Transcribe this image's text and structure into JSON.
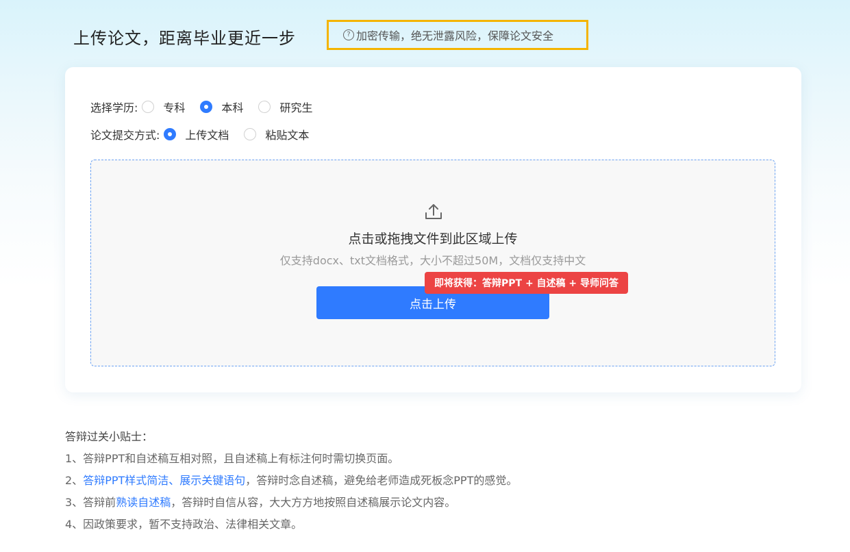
{
  "header": {
    "title": "上传论文，距离毕业更近一步",
    "notice": "加密传输，绝无泄露风险，保障论文安全",
    "notice_icon": "question-circle-icon"
  },
  "form": {
    "education_label": "选择学历:",
    "education_options": [
      {
        "label": "专科",
        "checked": false
      },
      {
        "label": "本科",
        "checked": true
      },
      {
        "label": "研究生",
        "checked": false
      }
    ],
    "submit_label": "论文提交方式:",
    "submit_options": [
      {
        "label": "上传文档",
        "checked": true
      },
      {
        "label": "粘贴文本",
        "checked": false
      }
    ]
  },
  "upload": {
    "icon": "upload-icon",
    "title": "点击或拖拽文件到此区域上传",
    "subtitle": "仅支持docx、txt文档格式，大小不超过50M，文档仅支持中文",
    "button_label": "点击上传",
    "promo": "即将获得：答辩PPT + 自述稿 + 导师问答"
  },
  "tips": {
    "title": "答辩过关小贴士：",
    "items": [
      {
        "prefix": "1、答辩PPT和自述稿互相对照，且自述稿上有标注何时需切换页面。",
        "highlight": "",
        "suffix": ""
      },
      {
        "prefix": "2、",
        "highlight": "答辩PPT样式简洁、展示关键语句",
        "suffix": "，答辩时念自述稿，避免给老师造成死板念PPT的感觉。"
      },
      {
        "prefix": "3、答辩前",
        "highlight": "熟读自述稿",
        "suffix": "，答辩时自信从容，大大方方地按照自述稿展示论文内容。"
      },
      {
        "prefix": "4、因政策要求，暂不支持政治、法律相关文章。",
        "highlight": "",
        "suffix": ""
      }
    ]
  },
  "colors": {
    "accent": "#2f7bff",
    "notice_border": "#f4b400",
    "promo_bg": "#ec4444"
  }
}
